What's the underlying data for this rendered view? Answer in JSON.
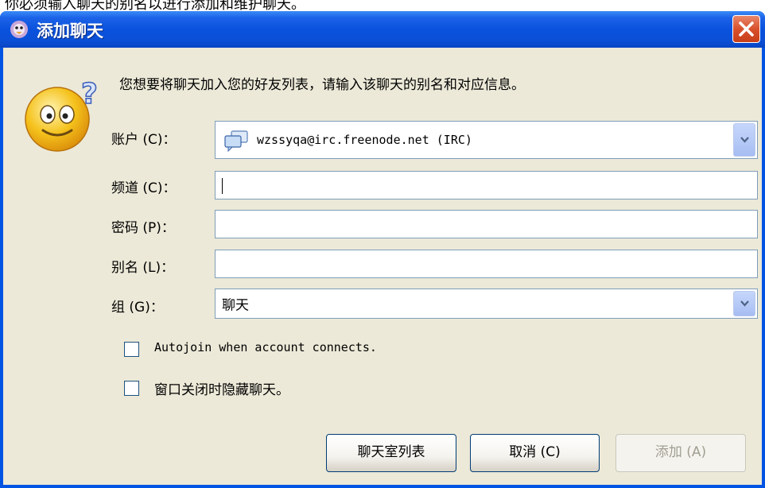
{
  "top_cut_text": "你必须输入聊天的别名以进行添加和维护聊天。",
  "window": {
    "title": "添加聊天"
  },
  "instruction": "您想要将聊天加入您的好友列表，请输入该聊天的别名和对应信息。",
  "form": {
    "account": {
      "label": "账户 (C)：",
      "value": "wzssyqa@irc.freenode.net (IRC)"
    },
    "channel": {
      "label": "频道 (C)：",
      "value": ""
    },
    "password": {
      "label": "密码 (P)：",
      "value": ""
    },
    "alias": {
      "label": "别名 (L)：",
      "value": ""
    },
    "group": {
      "label": "组 (G)：",
      "value": "聊天"
    }
  },
  "checkboxes": {
    "autojoin": {
      "label": "Autojoin when account connects.",
      "checked": false
    },
    "hide_on_close": {
      "label": "窗口关闭时隐藏聊天。",
      "checked": false
    }
  },
  "buttons": {
    "room_list": "聊天室列表",
    "cancel": "取消 (C)",
    "add": "添加 (A)"
  },
  "colors": {
    "titlebar": "#0a52dd",
    "client_bg": "#ece9d8",
    "close": "#d8512c"
  },
  "icons": {
    "title": "pidgin-icon",
    "smiley": "confused-smiley-icon",
    "account": "irc-chat-icon"
  }
}
